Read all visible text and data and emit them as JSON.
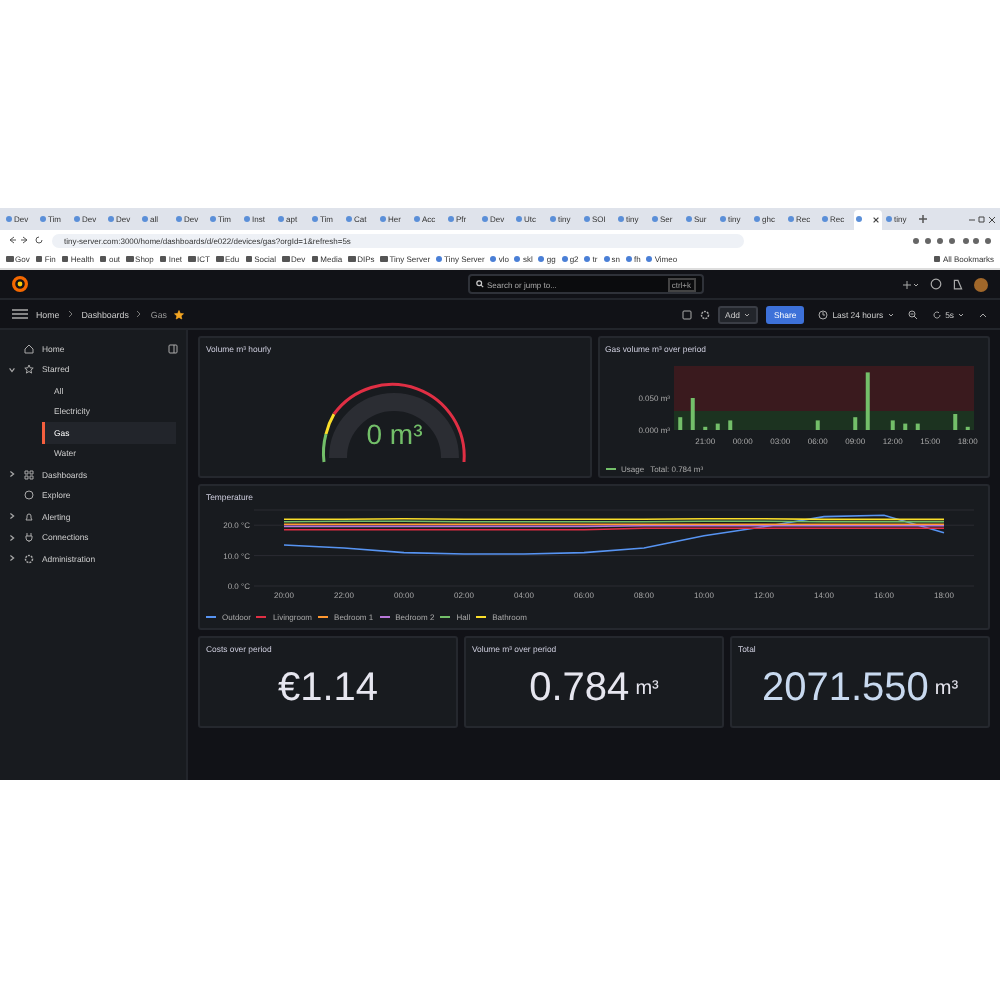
{
  "browser": {
    "tabs": [
      {
        "label": "Dev",
        "selected": false
      },
      {
        "label": "Tim",
        "selected": false
      },
      {
        "label": "Dev",
        "selected": false
      },
      {
        "label": "Dev",
        "selected": false
      },
      {
        "label": "all",
        "selected": false
      },
      {
        "label": "Dev",
        "selected": false
      },
      {
        "label": "Tim",
        "selected": false
      },
      {
        "label": "Inst",
        "selected": false
      },
      {
        "label": "apt",
        "selected": false
      },
      {
        "label": "Tim",
        "selected": false
      },
      {
        "label": "Cat",
        "selected": false
      },
      {
        "label": "Her",
        "selected": false
      },
      {
        "label": "Acc",
        "selected": false
      },
      {
        "label": "Pfr",
        "selected": false
      },
      {
        "label": "Dev",
        "selected": false
      },
      {
        "label": "Utc",
        "selected": false
      },
      {
        "label": "tiny",
        "selected": false
      },
      {
        "label": "SOI",
        "selected": false
      },
      {
        "label": "tiny",
        "selected": false
      },
      {
        "label": "Ser",
        "selected": false
      },
      {
        "label": "Sur",
        "selected": false
      },
      {
        "label": "tiny",
        "selected": false
      },
      {
        "label": "ghc",
        "selected": false
      },
      {
        "label": "Rec",
        "selected": false
      },
      {
        "label": "Rec",
        "selected": false
      },
      {
        "selected": true
      },
      {
        "label": "tiny",
        "selected": false
      }
    ],
    "url": "tiny-server.com:3000/home/dashboards/d/e022/devices/gas?orgId=1&refresh=5s",
    "bookmarks": [
      {
        "label": "Gov",
        "kind": "folder"
      },
      {
        "label": "Fin",
        "kind": "folder"
      },
      {
        "label": "Health",
        "kind": "folder"
      },
      {
        "label": "out",
        "kind": "folder"
      },
      {
        "label": "Shop",
        "kind": "folder"
      },
      {
        "label": "Inet",
        "kind": "folder"
      },
      {
        "label": "ICT",
        "kind": "folder"
      },
      {
        "label": "Edu",
        "kind": "folder"
      },
      {
        "label": "Social",
        "kind": "folder"
      },
      {
        "label": "Dev",
        "kind": "folder"
      },
      {
        "label": "Media",
        "kind": "folder"
      },
      {
        "label": "DIPs",
        "kind": "folder"
      },
      {
        "label": "Tiny Server",
        "kind": "folder"
      },
      {
        "label": "Tiny Server",
        "kind": "site"
      },
      {
        "label": "vlo",
        "kind": "site"
      },
      {
        "label": "skl",
        "kind": "site"
      },
      {
        "label": "gg",
        "kind": "site"
      },
      {
        "label": "g2",
        "kind": "site"
      },
      {
        "label": "tr",
        "kind": "site"
      },
      {
        "label": "sn",
        "kind": "site"
      },
      {
        "label": "fh",
        "kind": "site"
      },
      {
        "label": "Vimeo",
        "kind": "site"
      }
    ],
    "all_bookmarks": "All Bookmarks"
  },
  "header": {
    "search": {
      "placeholder": "Search or jump to...",
      "shortcut": "ctrl+k"
    }
  },
  "breadcrumbs": [
    "Home",
    "Dashboards",
    "Gas"
  ],
  "starred": true,
  "toolbar": {
    "add": "Add",
    "share": "Share",
    "time_range": "Last 24 hours",
    "refresh": "5s"
  },
  "sidebar": {
    "items": [
      {
        "label": "Home",
        "selected": false
      },
      {
        "label": "Starred",
        "selected": false,
        "expanded": true,
        "children": [
          {
            "label": "All",
            "selected": false
          },
          {
            "label": "Electricity",
            "selected": false
          },
          {
            "label": "Gas",
            "selected": true
          },
          {
            "label": "Water",
            "selected": false
          }
        ]
      },
      {
        "label": "Dashboards",
        "selected": false,
        "expanded": false
      },
      {
        "label": "Explore",
        "selected": false
      },
      {
        "label": "Alerting",
        "selected": false,
        "expanded": false
      },
      {
        "label": "Connections",
        "selected": false,
        "expanded": false
      },
      {
        "label": "Administration",
        "selected": false,
        "expanded": false
      }
    ]
  },
  "gauge_panel": {
    "title": "Volume m³ hourly",
    "value": "0",
    "unit": "m³"
  },
  "gas_panel": {
    "title": "Gas volume m³ over period",
    "legend": {
      "total": "Total: 0.784 m³"
    },
    "chart_data": {
      "type": "bar",
      "categories": [
        null,
        null,
        "21:00",
        null,
        null,
        "00:00",
        null,
        null,
        "03:00",
        null,
        null,
        "06:00",
        null,
        null,
        "09:00",
        null,
        null,
        "12:00",
        null,
        null,
        "15:00",
        null,
        null,
        "18:00"
      ],
      "series": [
        {
          "name": "Usage",
          "color": "#73bf69",
          "values": [
            0.02,
            0.05,
            0.005,
            0.01,
            0.015,
            0,
            0,
            0,
            0,
            0,
            0,
            0.015,
            0,
            0,
            0.02,
            0.09,
            0,
            0.015,
            0.01,
            0.01,
            0,
            0,
            0.025,
            0.005
          ]
        }
      ],
      "ylim": [
        0,
        0.1
      ],
      "yticks": [
        {
          "value": 0,
          "label": "0.000 m³"
        },
        {
          "value": 0.05,
          "label": "0.050 m³"
        }
      ]
    }
  },
  "temperature_panel": {
    "title": "Temperature",
    "chart_data": {
      "type": "line",
      "categories": [
        "20:00",
        "22:00",
        "00:00",
        "02:00",
        "04:00",
        "06:00",
        "08:00",
        "10:00",
        "12:00",
        "14:00",
        "16:00",
        "18:00"
      ],
      "series": [
        {
          "name": "Outdoor",
          "color": "#5794f2",
          "values": [
            13.5,
            12.5,
            11,
            10.5,
            10.5,
            11,
            12.5,
            16.5,
            19.5,
            22.8,
            23.3,
            17.5
          ]
        },
        {
          "name": "Livingroom",
          "color": "#e02f44",
          "values": [
            18.5,
            18.5,
            18.5,
            18.5,
            18.5,
            18.5,
            19,
            19,
            19,
            19,
            19,
            19
          ]
        },
        {
          "name": "Bedroom 1",
          "color": "#ff9830",
          "values": [
            20.3,
            20.3,
            20.3,
            20.3,
            20.3,
            20.3,
            20.3,
            20.3,
            20.3,
            20.3,
            20.3,
            20.3
          ]
        },
        {
          "name": "Bedroom 2",
          "color": "#b877d9",
          "values": [
            19.6,
            19.6,
            19.6,
            19.6,
            19.6,
            19.6,
            19.8,
            19.8,
            19.8,
            19.8,
            19.8,
            19.8
          ]
        },
        {
          "name": "Hall",
          "color": "#73bf69",
          "values": [
            21.1,
            21.3,
            21.3,
            21.1,
            21.1,
            21.1,
            21.1,
            21.3,
            21.3,
            21.1,
            21.1,
            21.1
          ]
        },
        {
          "name": "Bathroom",
          "color": "#fade2a",
          "values": [
            22,
            22,
            22.1,
            22,
            22,
            22,
            22,
            22.1,
            22.1,
            21.9,
            21.9,
            21.9
          ]
        }
      ],
      "ylim": [
        0,
        25
      ],
      "yticks": [
        {
          "value": 0,
          "label": "0.0 °C"
        },
        {
          "value": 10,
          "label": "10.0 °C"
        },
        {
          "value": 20,
          "label": "20.0 °C"
        }
      ]
    }
  },
  "stats": [
    {
      "title": "Costs over period",
      "value": "€1.14"
    },
    {
      "title": "Volume m³ over period",
      "value": "0.784",
      "unit": "m³"
    },
    {
      "title": "Total",
      "value": "2071.550",
      "unit": "m³"
    }
  ]
}
